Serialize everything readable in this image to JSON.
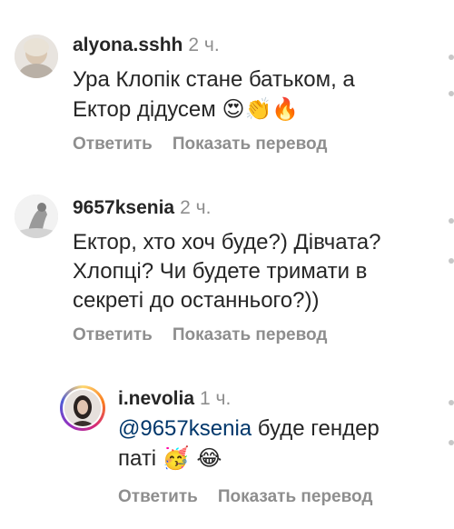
{
  "comments": [
    {
      "username": "alyona.sshh",
      "time": "2 ч.",
      "line1": "Ура Клопік стане батьком,  а",
      "line2": "Ектор дідусем",
      "emojis": "😍👏🔥",
      "reply_label": "Ответить",
      "translate_label": "Показать перевод"
    },
    {
      "username": "9657ksenia",
      "time": "2 ч.",
      "line1": "Ектор, хто хоч буде?) Дівчата?",
      "line2": "Хлопці?  Чи будете тримати в",
      "line3": "секреті до останнього?))",
      "reply_label": "Ответить",
      "translate_label": "Показать перевод"
    }
  ],
  "reply": {
    "username": "i.nevolia",
    "time": "1 ч.",
    "mention": "@9657ksenia",
    "line1_rest": " буде гендер",
    "line2": "паті ",
    "emojis": "🥳 😂",
    "reply_label": "Ответить",
    "translate_label": "Показать перевод"
  }
}
